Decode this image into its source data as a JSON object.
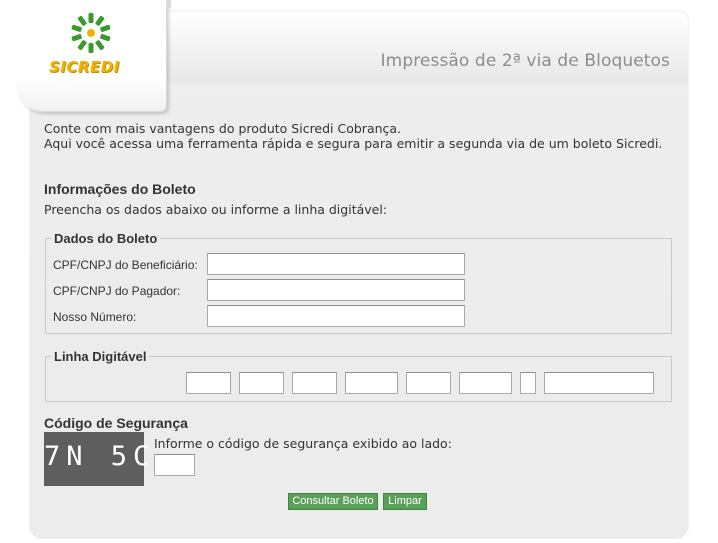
{
  "header": {
    "logo_text": "SICREDI",
    "title": "Impressão de 2ª via de Bloquetos"
  },
  "intro": {
    "line1": "Conte com mais vantagens do produto Sicredi Cobrança.",
    "line2": "Aqui você acessa uma ferramenta rápida e segura para emitir a segunda via de um boleto Sicredi."
  },
  "boleto_info": {
    "title": "Informações do Boleto",
    "subtitle": "Preencha os dados abaixo ou informe a linha digitável:"
  },
  "dados_boleto": {
    "legend": "Dados do Boleto",
    "fields": [
      {
        "label": "CPF/CNPJ do Beneficiário:",
        "value": "",
        "placeholder": ""
      },
      {
        "label": "CPF/CNPJ do Pagador:",
        "value": "",
        "placeholder": ""
      },
      {
        "label": "Nosso Número:",
        "value": "",
        "placeholder": ""
      }
    ]
  },
  "linha_digitavel": {
    "legend": "Linha Digitável",
    "segments": [
      "",
      "",
      "",
      "",
      "",
      "",
      "",
      ""
    ]
  },
  "security": {
    "title": "Código de Segurança",
    "captcha_text": "7N 5C",
    "instruction": "Informe o código de segurança exibido ao lado:",
    "value": ""
  },
  "actions": {
    "submit_label": "Consultar Boleto",
    "clear_label": "Limpar"
  },
  "colors": {
    "brand_green": "#3a9a2e",
    "brand_yellow": "#f2b300",
    "button_green": "#5aa05a"
  }
}
